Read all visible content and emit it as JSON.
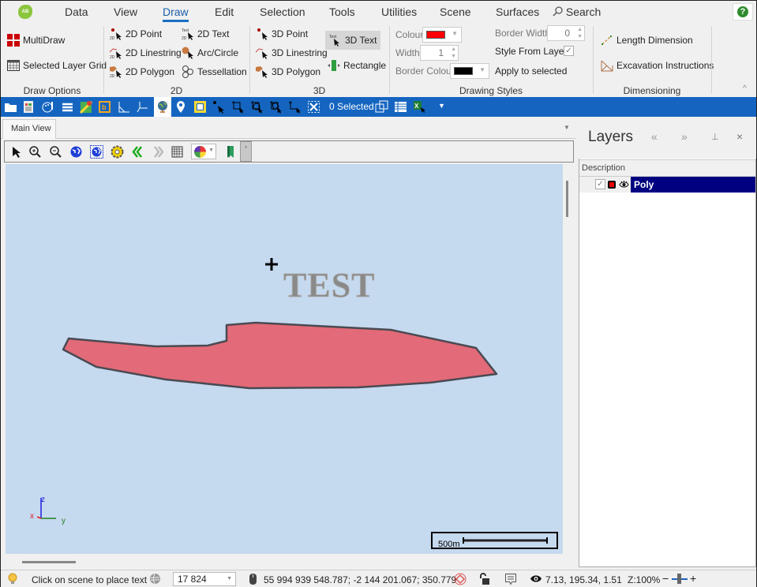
{
  "menu": {
    "items": [
      "Data",
      "View",
      "Draw",
      "Edit",
      "Selection",
      "Tools",
      "Utilities",
      "Scene",
      "Surfaces"
    ],
    "active": "Draw",
    "search_label": "Search",
    "help_label": "?",
    "logo_text": "AB"
  },
  "ribbon": {
    "draw_options": {
      "multidraw": "MultiDraw",
      "selected_layer_grid": "Selected Layer Grid",
      "group_label": "Draw Options"
    },
    "two_d": {
      "point": "2D Point",
      "text": "2D Text",
      "linestring": "2D Linestring",
      "arc_circle": "Arc/Circle",
      "polygon": "2D Polygon",
      "tessellation": "Tessellation",
      "group_label": "2D"
    },
    "three_d": {
      "point": "3D Point",
      "text": "3D Text",
      "linestring": "3D Linestring",
      "rectangle": "Rectangle",
      "polygon": "3D Polygon",
      "group_label": "3D"
    },
    "drawing_styles": {
      "colour_label": "Colour",
      "colour_value": "#ff0000",
      "width_label": "Width",
      "width_value": "1",
      "border_colour_label": "Border Colour",
      "border_colour_value": "#000000",
      "border_width_label": "Border Width",
      "border_width_value": "0",
      "style_from_layer_label": "Style From Layer",
      "style_from_layer_checked": true,
      "apply_label": "Apply to selected",
      "group_label": "Drawing Styles"
    },
    "dimensioning": {
      "length": "Length Dimension",
      "excavation": "Excavation Instructions",
      "group_label": "Dimensioning"
    }
  },
  "toolbar": {
    "selected_count": "0 Selected",
    "icons": [
      "open-folder-icon",
      "report-icon",
      "palette-icon",
      "layers-icon",
      "google-maps-icon",
      "bing-icon",
      "measure-angle-icon",
      "axis-icon",
      "globe-icon",
      "location-pin-icon",
      "frame-icon",
      "select-point-icon",
      "select-box-icon",
      "select-circle-icon",
      "select-polygon-icon",
      "select-line-icon",
      "clear-selection-icon",
      "selection-export-icon",
      "selection-grid-icon",
      "excel-export-icon",
      "overflow-dropdown-icon"
    ]
  },
  "main_view": {
    "tab_label": "Main View",
    "tools": [
      "pointer-icon",
      "zoom-in-icon",
      "zoom-out-icon",
      "globe-extent-icon",
      "globe-zoom-icon",
      "settings-gear-icon",
      "previous-view-icon",
      "next-view-icon",
      "grid-icon",
      "palette-dropdown-icon",
      "bookmark-icon",
      "pin-icon"
    ],
    "scene": {
      "text_object": "TEST",
      "polygon_fill": "#e36a78",
      "background": "#c5d9ef",
      "axis_labels": {
        "x": "x",
        "y": "y",
        "z": "z"
      },
      "scale_bar_label": "500m"
    }
  },
  "layers": {
    "title": "Layers",
    "column_header": "Description",
    "rows": [
      {
        "name": "Poly",
        "visible": true,
        "checked": true,
        "color": "#ff0000"
      }
    ]
  },
  "status": {
    "hint": "Click on scene to place text",
    "scale_value": "17 824",
    "coordinates": "55 994 939 548.787; -2 144 201.067; 350.779",
    "camera": "7.13, 195.34, 1.51",
    "zoom": "Z:100%"
  }
}
